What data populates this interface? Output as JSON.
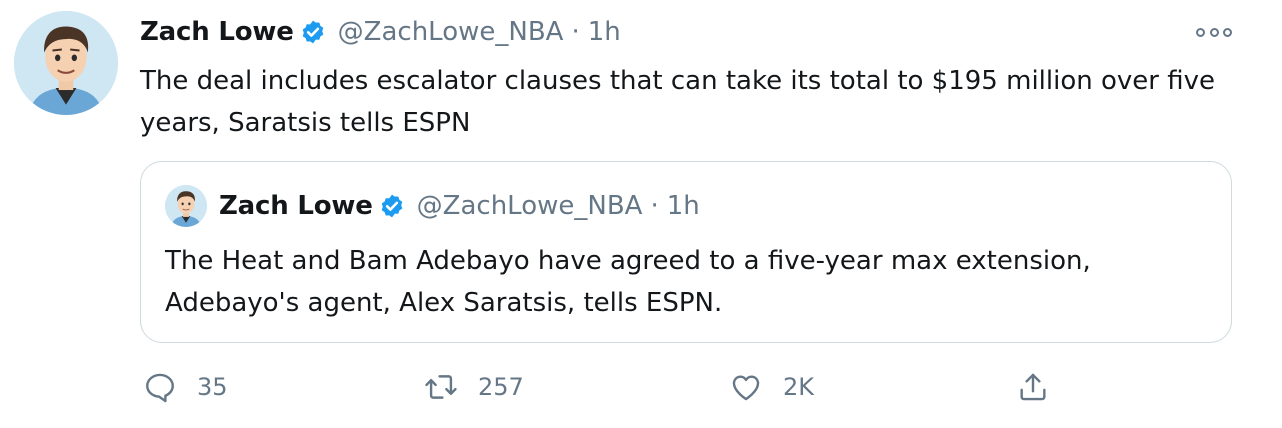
{
  "tweet": {
    "author_name": "Zach Lowe",
    "handle": "@ZachLowe_NBA",
    "separator": "·",
    "time": "1h",
    "text": "The deal includes escalator clauses that can take its total to $195 million over five years, Saratsis tells ESPN",
    "verified": true
  },
  "quoted": {
    "author_name": "Zach Lowe",
    "handle": "@ZachLowe_NBA",
    "separator": "·",
    "time": "1h",
    "text": "The Heat and Bam Adebayo have  agreed to a five-year max extension, Adebayo's agent, Alex Saratsis, tells ESPN.",
    "verified": true
  },
  "actions": {
    "reply_count": "35",
    "retweet_count": "257",
    "like_count": "2K"
  },
  "icons": {
    "verified": "verified-badge-icon",
    "more": "more-options-icon",
    "reply": "reply-icon",
    "retweet": "retweet-icon",
    "like": "heart-icon",
    "share": "share-icon"
  },
  "colors": {
    "verified_blue": "#1d9bf0",
    "secondary_text": "#657786",
    "primary_text": "#14171a",
    "border": "#cfd9de"
  }
}
